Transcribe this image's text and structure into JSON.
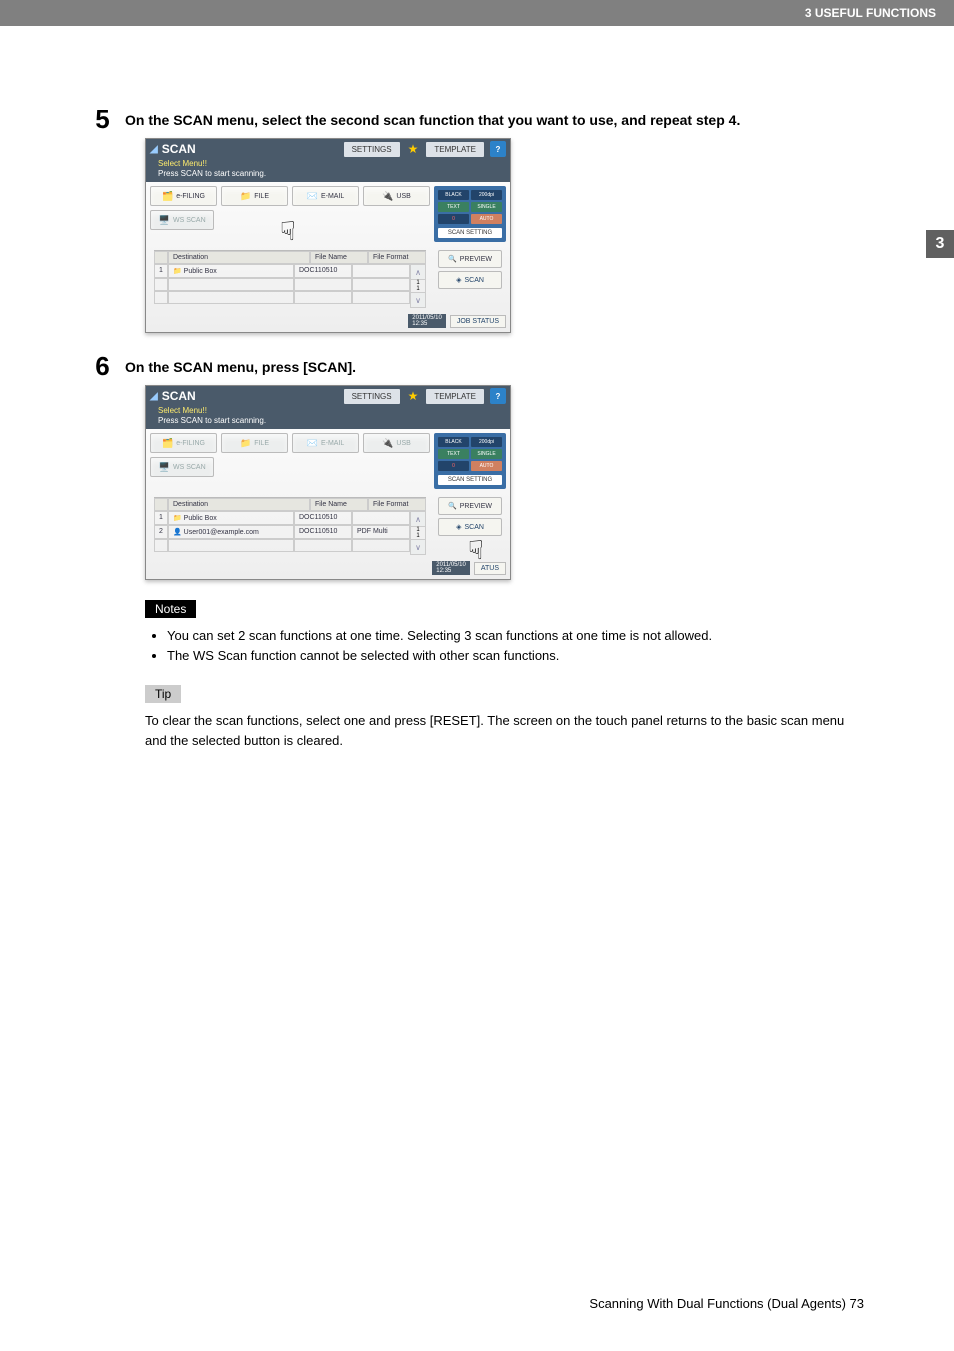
{
  "header": {
    "section": "3 USEFUL FUNCTIONS"
  },
  "sidetab": {
    "num": "3"
  },
  "steps": {
    "s5": {
      "num": "5",
      "text": "On the SCAN menu, select the second scan function that you want to use, and repeat step 4."
    },
    "s6": {
      "num": "6",
      "text": "On the SCAN menu, press [SCAN]."
    }
  },
  "screen": {
    "title": "SCAN",
    "subtitle1": "Select Menu!!",
    "subtitle2": "Press SCAN to start scanning.",
    "topbuttons": {
      "settings": "SETTINGS",
      "template": "TEMPLATE",
      "help": "?"
    },
    "fn": {
      "efiling": "e-FILING",
      "file": "FILE",
      "email": "E-MAIL",
      "usb": "USB",
      "wsscan": "WS SCAN"
    },
    "right": {
      "black": "BLACK",
      "dpi": "200dpi",
      "text": "TEXT",
      "single": "SINGLE",
      "zero": "0",
      "auto": "AUTO",
      "scansetting": "SCAN SETTING"
    },
    "dest": {
      "hdr_destination": "Destination",
      "hdr_filename": "File Name",
      "hdr_fileformat": "File Format",
      "rows5": [
        {
          "idx": "1",
          "destination": "Public Box",
          "filename": "DOC110510",
          "fileformat": ""
        }
      ],
      "rows6": [
        {
          "idx": "1",
          "destination": "Public Box",
          "filename": "DOC110510",
          "fileformat": ""
        },
        {
          "idx": "2",
          "destination": "User001@example.com",
          "filename": "DOC110510",
          "fileformat": "PDF Multi"
        }
      ]
    },
    "side": {
      "preview": "PREVIEW",
      "scan": "SCAN"
    },
    "bottom": {
      "date": "2011/05/10",
      "time": "12:35",
      "jobstatus": "JOB STATUS",
      "jobstatus_partial": "ATUS"
    }
  },
  "notes": {
    "label": "Notes",
    "items": [
      "You can set 2 scan functions at one time. Selecting 3 scan functions at one time is not allowed.",
      "The WS Scan function cannot be selected with other scan functions."
    ]
  },
  "tip": {
    "label": "Tip",
    "text": "To clear the scan functions, select one and press [RESET]. The screen on the touch panel returns to the basic scan menu and the selected button is cleared."
  },
  "footer": {
    "text": "Scanning With Dual Functions (Dual Agents)    73"
  }
}
